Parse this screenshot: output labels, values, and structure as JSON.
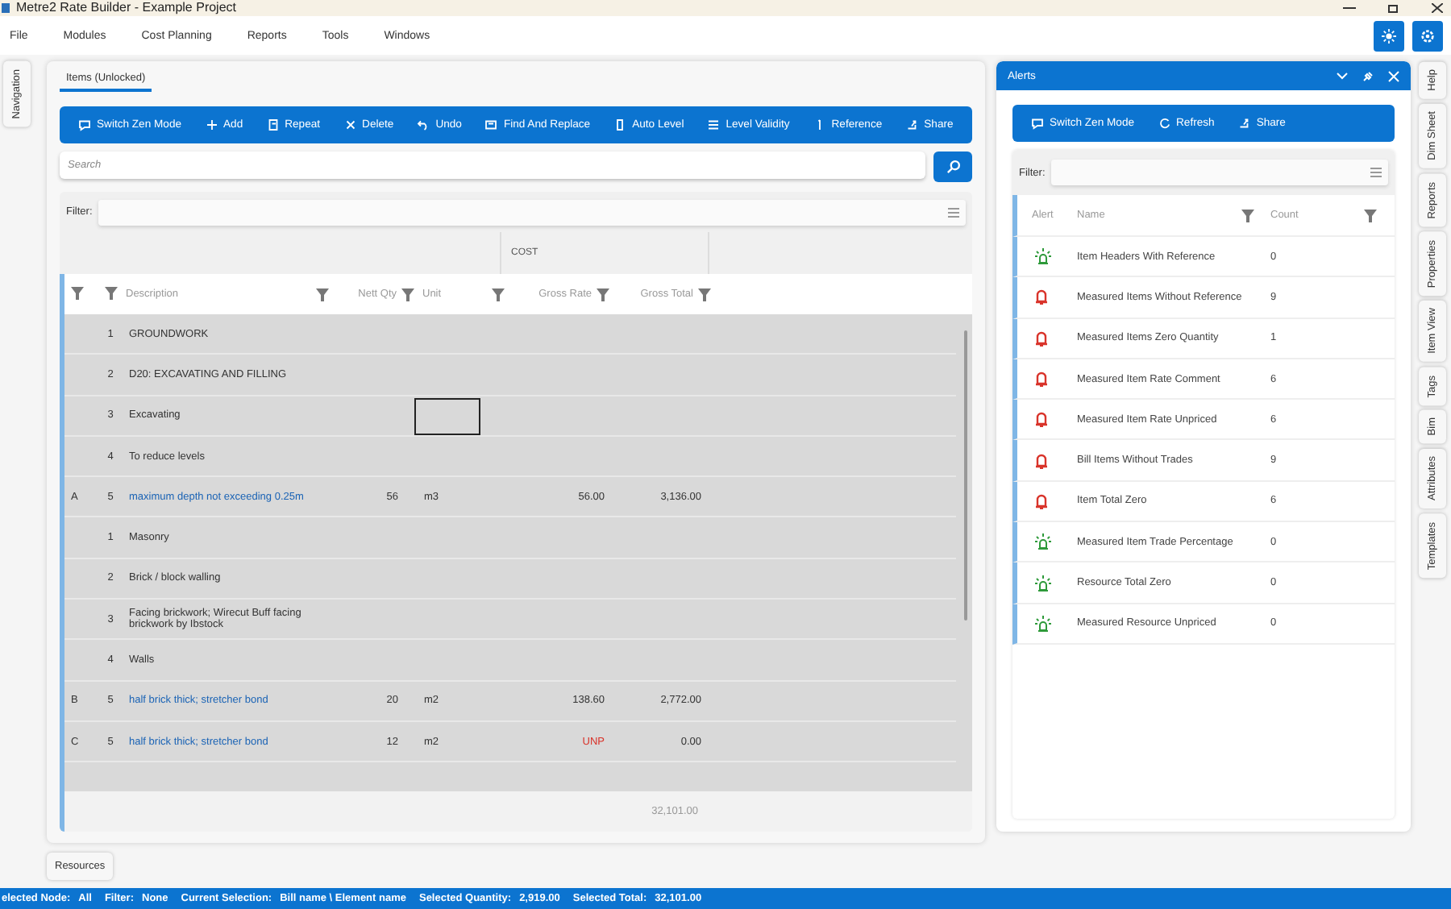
{
  "window": {
    "title": "Metre2 Rate Builder - Example Project"
  },
  "menu": [
    "File",
    "Modules",
    "Cost Planning",
    "Reports",
    "Tools",
    "Windows"
  ],
  "left_tabs": [
    "Navigation"
  ],
  "main": {
    "tab": "Items (Unlocked)",
    "toolbar": [
      "Switch Zen Mode",
      "Add",
      "Repeat",
      "Delete",
      "Undo",
      "Find And Replace",
      "Auto Level",
      "Level Validity",
      "Reference",
      "Share"
    ],
    "search": {
      "placeholder": "Search"
    },
    "filter_label": "Filter:",
    "group_header": "COST",
    "columns": [
      "Description",
      "Nett Qty",
      "Unit",
      "Gross Rate",
      "Gross Total"
    ],
    "rows": [
      {
        "kind": "heading",
        "letter": "",
        "number": "1",
        "description": "GROUNDWORK",
        "qty": "",
        "unit": "",
        "rate": "",
        "total": "",
        "focused": false
      },
      {
        "kind": "heading",
        "letter": "",
        "number": "2",
        "description": "D20: EXCAVATING AND FILLING",
        "qty": "",
        "unit": "",
        "rate": "",
        "total": "",
        "focused": false
      },
      {
        "kind": "heading",
        "letter": "",
        "number": "3",
        "description": "Excavating",
        "qty": "",
        "unit": "",
        "rate": "",
        "total": "",
        "focused": true
      },
      {
        "kind": "heading",
        "letter": "",
        "number": "4",
        "description": "To reduce levels",
        "qty": "",
        "unit": "",
        "rate": "",
        "total": "",
        "focused": false
      },
      {
        "kind": "item",
        "letter": "A",
        "number": "5",
        "description": "maximum depth not exceeding 0.25m",
        "qty": "56",
        "unit": "m3",
        "rate": "56.00",
        "unpriced": false,
        "total": "3,136.00",
        "focused": false
      },
      {
        "kind": "heading",
        "letter": "",
        "number": "1",
        "description": "Masonry",
        "qty": "",
        "unit": "",
        "rate": "",
        "total": "",
        "focused": false
      },
      {
        "kind": "heading",
        "letter": "",
        "number": "2",
        "description": "Brick / block walling",
        "qty": "",
        "unit": "",
        "rate": "",
        "total": "",
        "focused": false
      },
      {
        "kind": "heading",
        "letter": "",
        "number": "3",
        "description": "Facing brickwork; Wirecut Buff facing brickwork by Ibstock",
        "qty": "",
        "unit": "",
        "rate": "",
        "total": "",
        "focused": false
      },
      {
        "kind": "heading",
        "letter": "",
        "number": "4",
        "description": "Walls",
        "qty": "",
        "unit": "",
        "rate": "",
        "total": "",
        "focused": false
      },
      {
        "kind": "item",
        "letter": "B",
        "number": "5",
        "description": "half brick thick; stretcher bond",
        "qty": "20",
        "unit": "m2",
        "rate": "138.60",
        "unpriced": false,
        "total": "2,772.00",
        "focused": false
      },
      {
        "kind": "item",
        "letter": "C",
        "number": "5",
        "description": "half brick thick; stretcher bond",
        "qty": "12",
        "unit": "m2",
        "rate": "UNP",
        "unpriced": true,
        "total": "0.00",
        "focused": false
      }
    ],
    "footer_total": "32,101.00"
  },
  "bottom_tab": "Resources",
  "alerts": {
    "title": "Alerts",
    "toolbar": [
      "Switch Zen Mode",
      "Refresh",
      "Share"
    ],
    "filter_label": "Filter:",
    "columns": [
      "Alert",
      "Name",
      "Count"
    ],
    "rows": [
      {
        "kind": "ok",
        "name": "Item Headers With Reference",
        "count": "0"
      },
      {
        "kind": "warning",
        "name": "Measured Items Without Reference",
        "count": "9"
      },
      {
        "kind": "warning",
        "name": "Measured Items Zero Quantity",
        "count": "1"
      },
      {
        "kind": "warning",
        "name": "Measured Item Rate Comment",
        "count": "6"
      },
      {
        "kind": "warning",
        "name": "Measured Item Rate Unpriced",
        "count": "6"
      },
      {
        "kind": "warning",
        "name": "Bill Items Without Trades",
        "count": "9"
      },
      {
        "kind": "warning",
        "name": "Item Total Zero",
        "count": "6"
      },
      {
        "kind": "ok",
        "name": "Measured Item Trade Percentage",
        "count": "0"
      },
      {
        "kind": "ok",
        "name": "Resource Total Zero",
        "count": "0"
      },
      {
        "kind": "ok",
        "name": "Measured Resource Unpriced",
        "count": "0"
      }
    ]
  },
  "right_tabs": [
    "Help",
    "Dim Sheet",
    "Reports",
    "Properties",
    "Item View",
    "Tags",
    "Bim",
    "Attributes",
    "Templates"
  ],
  "status_bar": [
    {
      "label": "elected Node:",
      "value": "All"
    },
    {
      "label": "Filter:",
      "value": "None"
    },
    {
      "label": "Current Selection:",
      "value": "Bill name \\ Element name"
    },
    {
      "label": "Selected Quantity:",
      "value": "2,919.00"
    },
    {
      "label": "Selected Total:",
      "value": "32,101.00"
    }
  ]
}
